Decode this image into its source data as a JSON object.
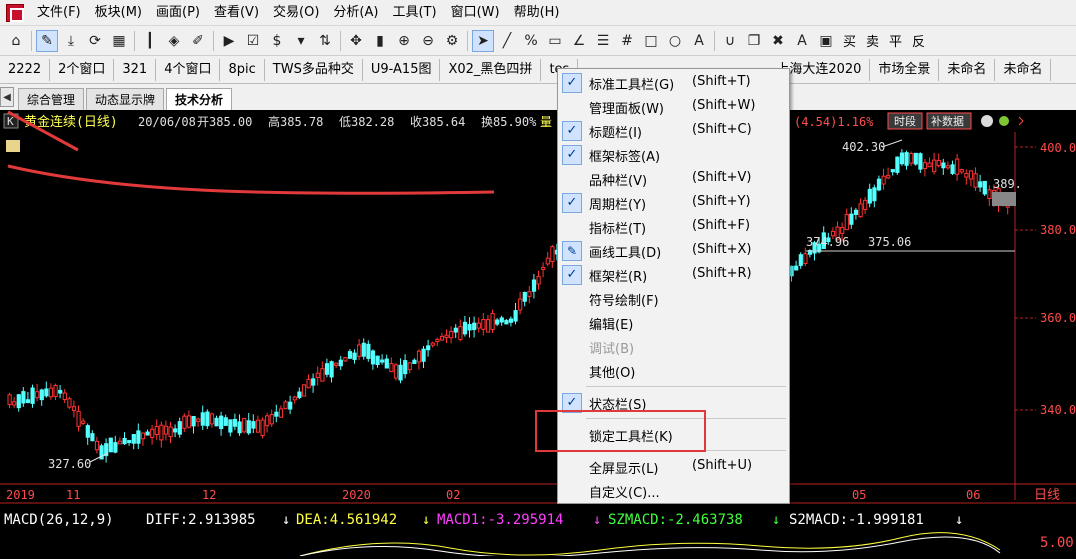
{
  "menubar": {
    "items": [
      "文件(F)",
      "板块(M)",
      "画面(P)",
      "查看(V)",
      "交易(O)",
      "分析(A)",
      "工具(T)",
      "窗口(W)",
      "帮助(H)"
    ]
  },
  "toolbar": {
    "right_labels": [
      "买",
      "卖",
      "平",
      "反"
    ]
  },
  "tabs_row1": [
    "2222",
    "2个窗口",
    "321",
    "4个窗口",
    "8pic",
    "TWS多品种交",
    "U9-A15图",
    "X02_黑色四拼",
    "tes",
    "上海大连2020",
    "市场全景",
    "未命名",
    "未命名"
  ],
  "tabs_row2": [
    "综合管理",
    "动态显示牌",
    "技术分析"
  ],
  "title_bar": {
    "prefix": "K",
    "name": "黄金连续(日线)",
    "date": "20/06/08",
    "open": "开385.00",
    "high": "高385.78",
    "low": "低382.28",
    "close": "收385.64",
    "turnover": "换85.90%",
    "vol": "量",
    "change": "(4.54)1.16%",
    "btn_period": "时段",
    "btn_fill": "补数据"
  },
  "price_axis": [
    "400.00",
    "380.00",
    "360.00",
    "340.00"
  ],
  "annotations": {
    "high_label": "402.30",
    "low_label": "327.60",
    "mid_label_1": "374.96",
    "mid_label_2": "375.06",
    "last_price": "389."
  },
  "time_axis": [
    "2019",
    "11",
    "12",
    "2020",
    "02",
    "05",
    "06"
  ],
  "time_axis_right": "日线",
  "macd": {
    "label": "MACD(26,12,9)",
    "diff": "DIFF:2.913985",
    "dea": "DEA:4.561942",
    "macd1": "MACD1:-3.295914",
    "szmacd": "SZMACD:-2.463738",
    "s2macd": "S2MACD:-1.999181",
    "axis_value": "5.00"
  },
  "context_menu": {
    "items": [
      {
        "label": "标准工具栏(G)",
        "shortcut": "(Shift+T)",
        "checked": true
      },
      {
        "label": "管理面板(W)",
        "shortcut": "(Shift+W)",
        "checked": false
      },
      {
        "label": "标题栏(I)",
        "shortcut": "(Shift+C)",
        "checked": true
      },
      {
        "label": "框架标签(A)",
        "shortcut": "",
        "checked": true
      },
      {
        "label": "品种栏(V)",
        "shortcut": "(Shift+V)",
        "checked": false
      },
      {
        "label": "周期栏(Y)",
        "shortcut": "(Shift+Y)",
        "checked": true
      },
      {
        "label": "指标栏(T)",
        "shortcut": "(Shift+F)",
        "checked": false
      },
      {
        "label": "画线工具(D)",
        "shortcut": "(Shift+X)",
        "checked": false
      },
      {
        "label": "框架栏(R)",
        "shortcut": "(Shift+R)",
        "checked": true
      },
      {
        "label": "符号绘制(F)",
        "shortcut": "",
        "checked": false
      },
      {
        "label": "编辑(E)",
        "shortcut": "",
        "checked": false
      },
      {
        "label": "调试(B)",
        "shortcut": "",
        "checked": false
      },
      {
        "label": "其他(O)",
        "shortcut": "",
        "checked": false
      },
      {
        "label": "状态栏(S)",
        "shortcut": "",
        "checked": true
      },
      {
        "label": "锁定工具栏(K)",
        "shortcut": "",
        "checked": false
      },
      {
        "label": "全屏显示(L)",
        "shortcut": "(Shift+U)",
        "checked": false
      },
      {
        "label": "自定义(C)...",
        "shortcut": "",
        "checked": false
      }
    ]
  },
  "colors": {
    "up": "#ff3232",
    "down": "#54ffff",
    "highlight_box": "#e0393c",
    "annotation_stroke": "#ff3b3b"
  }
}
